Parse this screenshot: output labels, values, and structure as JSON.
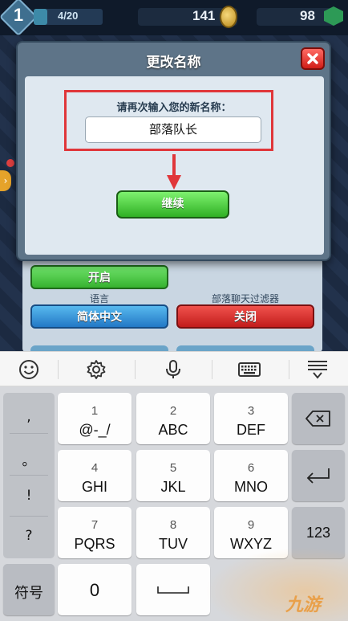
{
  "hud": {
    "level": "1",
    "xp_text": "4/20",
    "xp_fraction": 0.2,
    "coins": "141",
    "gems": "98"
  },
  "settings_panel": {
    "toggle_label": "开启",
    "language_label": "语言",
    "language_value": "简体中文",
    "filter_label": "部落聊天过滤器",
    "filter_value": "关闭"
  },
  "dialog": {
    "title": "更改名称",
    "prompt": "请再次输入您的新名称：",
    "name_value": "部落队长",
    "continue_label": "继续"
  },
  "keyboard": {
    "toolbar_icons": [
      "emoji-icon",
      "settings-icon",
      "microphone-icon",
      "keyboard-icon",
      "collapse-keyboard-icon"
    ],
    "punctuation": [
      ",",
      "。",
      "!",
      "?"
    ],
    "keys": [
      {
        "num": "1",
        "letters": "@-_/"
      },
      {
        "num": "2",
        "letters": "ABC"
      },
      {
        "num": "3",
        "letters": "DEF"
      },
      {
        "num": "4",
        "letters": "GHI"
      },
      {
        "num": "5",
        "letters": "JKL"
      },
      {
        "num": "6",
        "letters": "MNO"
      },
      {
        "num": "7",
        "letters": "PQRS"
      },
      {
        "num": "8",
        "letters": "TUV"
      },
      {
        "num": "9",
        "letters": "WXYZ"
      }
    ],
    "symbols_label": "符号",
    "zero_label": "0",
    "numbers_label": "123"
  },
  "watermark": "九游",
  "colors": {
    "dialog_bg": "#5e7488",
    "continue_green": "#2fb024",
    "close_red": "#d21d17",
    "highlight_red": "#e0363a",
    "language_blue": "#2278c6"
  }
}
